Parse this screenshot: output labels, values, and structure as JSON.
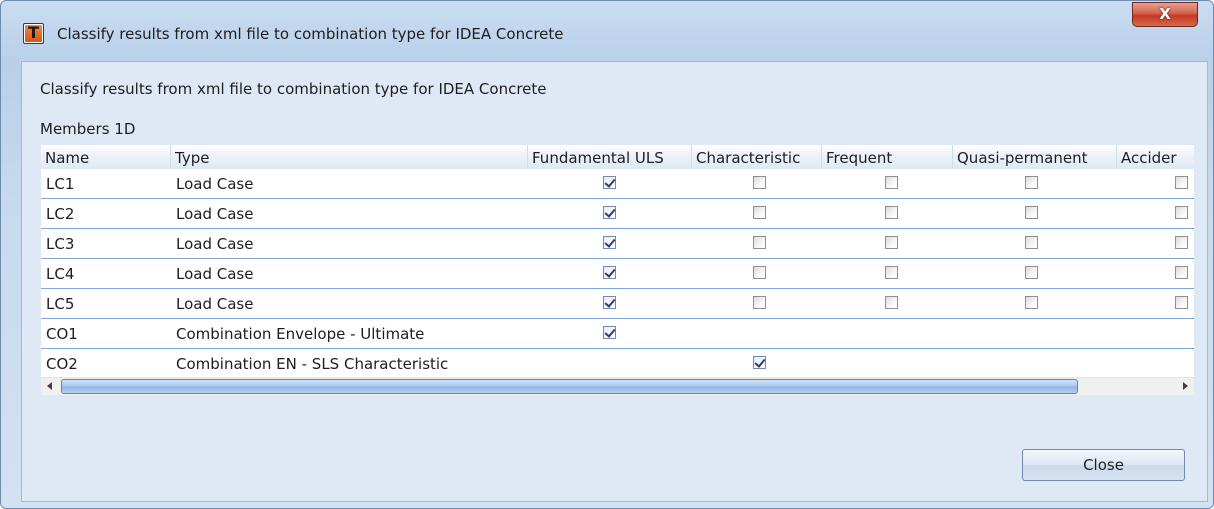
{
  "window": {
    "title": "Classify results from xml file to combination type for IDEA Concrete",
    "close_glyph": "X",
    "app_icon_glyph": "T"
  },
  "dialog": {
    "heading": "Classify results from xml file to combination type for IDEA Concrete",
    "section_label": "Members 1D",
    "close_button": "Close"
  },
  "table": {
    "columns": [
      "Name",
      "Type",
      "Fundamental ULS",
      "Characteristic",
      "Frequent",
      "Quasi-permanent",
      "Accider"
    ],
    "rows": [
      {
        "name": "LC1",
        "type": "Load Case",
        "checks": [
          true,
          false,
          false,
          false,
          false
        ]
      },
      {
        "name": "LC2",
        "type": "Load Case",
        "checks": [
          true,
          false,
          false,
          false,
          false
        ]
      },
      {
        "name": "LC3",
        "type": "Load Case",
        "checks": [
          true,
          false,
          false,
          false,
          false
        ]
      },
      {
        "name": "LC4",
        "type": "Load Case",
        "checks": [
          true,
          false,
          false,
          false,
          false
        ]
      },
      {
        "name": "LC5",
        "type": "Load Case",
        "checks": [
          true,
          false,
          false,
          false,
          false
        ]
      },
      {
        "name": "CO1",
        "type": "Combination Envelope - Ultimate",
        "checks": [
          true,
          null,
          null,
          null,
          null
        ]
      },
      {
        "name": "CO2",
        "type": "Combination EN - SLS Characteristic",
        "checks": [
          null,
          true,
          null,
          null,
          null
        ]
      }
    ]
  },
  "colors": {
    "title_close_red": "#c23a22",
    "row_separator": "#7fa7db",
    "scroll_thumb": "#a6c6ec"
  }
}
